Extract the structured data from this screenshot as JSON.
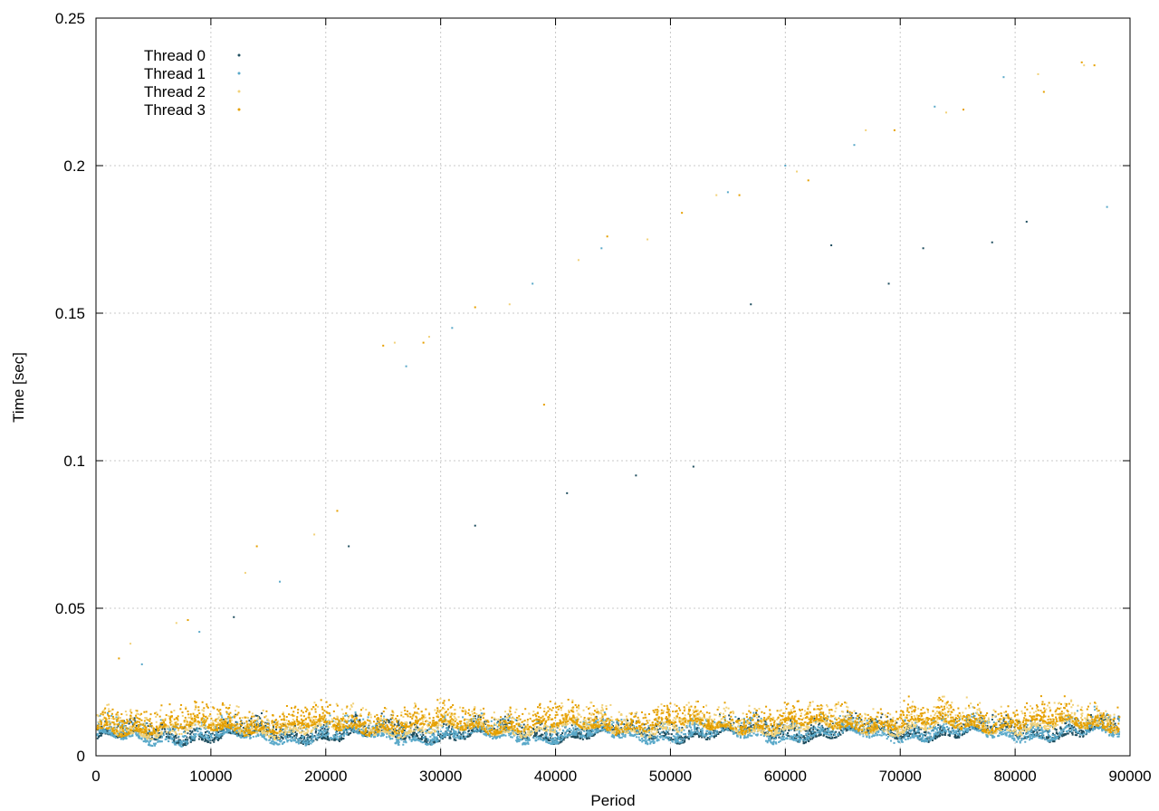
{
  "chart_data": {
    "type": "scatter",
    "title": "",
    "xlabel": "Period",
    "ylabel": "Time [sec]",
    "xlim": [
      0,
      90000
    ],
    "ylim": [
      0,
      0.25
    ],
    "xticks": [
      0,
      10000,
      20000,
      30000,
      40000,
      50000,
      60000,
      70000,
      80000,
      90000
    ],
    "yticks": [
      0,
      0.05,
      0.1,
      0.15,
      0.2,
      0.25
    ],
    "ytick_labels": [
      "0",
      "0.05",
      "0.1",
      "0.15",
      "0.2",
      "0.25"
    ],
    "grid": true,
    "legend_position": "top-left",
    "series": [
      {
        "name": "Thread 0",
        "color": "#1f4e5f",
        "marker": "dot",
        "band": {
          "x_range": [
            0,
            89000
          ],
          "baseline": 0.006,
          "spread": 0.007
        },
        "points": [
          [
            12000,
            0.047
          ],
          [
            22000,
            0.071
          ],
          [
            33000,
            0.078
          ],
          [
            41000,
            0.089
          ],
          [
            47000,
            0.095
          ],
          [
            52000,
            0.098
          ],
          [
            57000,
            0.153
          ],
          [
            64000,
            0.173
          ],
          [
            69000,
            0.16
          ],
          [
            72000,
            0.172
          ],
          [
            78000,
            0.174
          ],
          [
            81000,
            0.181
          ]
        ]
      },
      {
        "name": "Thread 1",
        "color": "#5aa9c9",
        "marker": "dot",
        "band": {
          "x_range": [
            0,
            89000
          ],
          "baseline": 0.0055,
          "spread": 0.008
        },
        "points": [
          [
            4000,
            0.031
          ],
          [
            9000,
            0.042
          ],
          [
            16000,
            0.059
          ],
          [
            27000,
            0.132
          ],
          [
            31000,
            0.145
          ],
          [
            38000,
            0.16
          ],
          [
            44000,
            0.172
          ],
          [
            55000,
            0.191
          ],
          [
            60000,
            0.2
          ],
          [
            66000,
            0.207
          ],
          [
            73000,
            0.22
          ],
          [
            79000,
            0.23
          ],
          [
            88000,
            0.186
          ]
        ]
      },
      {
        "name": "Thread 2",
        "color": "#f2d27a",
        "marker": "dot",
        "band": {
          "x_range": [
            0,
            89000
          ],
          "baseline": 0.008,
          "spread": 0.01
        },
        "points": [
          [
            3000,
            0.038
          ],
          [
            7000,
            0.045
          ],
          [
            13000,
            0.062
          ],
          [
            19000,
            0.075
          ],
          [
            26000,
            0.14
          ],
          [
            29000,
            0.142
          ],
          [
            36000,
            0.153
          ],
          [
            42000,
            0.168
          ],
          [
            48000,
            0.175
          ],
          [
            54000,
            0.19
          ],
          [
            61000,
            0.198
          ],
          [
            67000,
            0.212
          ],
          [
            74000,
            0.218
          ],
          [
            82000,
            0.231
          ],
          [
            86000,
            0.234
          ]
        ]
      },
      {
        "name": "Thread 3",
        "color": "#e6a000",
        "marker": "dot",
        "band": {
          "x_range": [
            0,
            89000
          ],
          "baseline": 0.009,
          "spread": 0.009
        },
        "points": [
          [
            2000,
            0.033
          ],
          [
            8000,
            0.046
          ],
          [
            14000,
            0.071
          ],
          [
            21000,
            0.083
          ],
          [
            25000,
            0.139
          ],
          [
            28500,
            0.14
          ],
          [
            33000,
            0.152
          ],
          [
            39000,
            0.119
          ],
          [
            44500,
            0.176
          ],
          [
            51000,
            0.184
          ],
          [
            56000,
            0.19
          ],
          [
            62000,
            0.195
          ],
          [
            69500,
            0.212
          ],
          [
            75500,
            0.219
          ],
          [
            82500,
            0.225
          ],
          [
            85800,
            0.235
          ],
          [
            86900,
            0.234
          ]
        ]
      }
    ]
  }
}
